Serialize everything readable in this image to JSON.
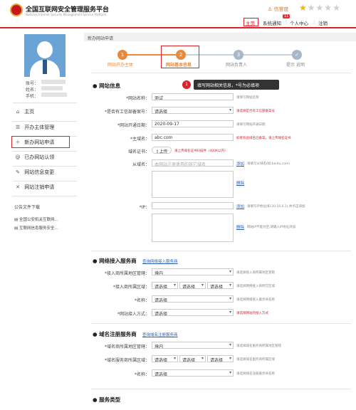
{
  "header": {
    "title": "全国互联网安全管理服务平台",
    "subtitle": "National Internet Security Management Service Platform",
    "level_label": "信誉度",
    "stars_on": 1,
    "stars_total": 5,
    "nav": [
      "主页",
      "系统通知",
      "个人中心",
      "注销"
    ],
    "notice_count": "11"
  },
  "sidebar": {
    "account_label": "账号：",
    "name_label": "姓名：",
    "phone_label": "手机：",
    "items": [
      {
        "icon": "home-icon",
        "label": "主页"
      },
      {
        "icon": "list-icon",
        "label": "开办主体管理"
      },
      {
        "icon": "plus-icon",
        "label": "新办网站申请"
      },
      {
        "icon": "at-icon",
        "label": "已办网站认领"
      },
      {
        "icon": "edit-icon",
        "label": "网站信息变更"
      },
      {
        "icon": "close-icon",
        "label": "网站注销申请"
      }
    ],
    "downloads_title": "公告文件下载",
    "downloads": [
      "全国公安机关互联网...",
      "互联网信息服务安全..."
    ]
  },
  "main": {
    "title": "新办网站申请",
    "steps": [
      "网站开办主体",
      "网站基本信息",
      "网站负责人",
      "提示 说明"
    ],
    "tooltip": "填写网站相关信息，*号为必填项",
    "tooltip_num": "1",
    "site_section": "网站信息",
    "site_name_label": "*网站名称：",
    "site_name_value": "测试",
    "site_name_hint": "请填写网站名称",
    "record_label": "*是否有工信部备案号：",
    "record_value": "请选择",
    "record_hint": "请选择是否有工信部备案号",
    "open_date_label": "*网站开通日期：",
    "open_date_value": "2020-09-17",
    "open_date_hint": "请填写网站开通日期",
    "domain_label": "*主域名：",
    "domain_value": "abc.com",
    "domain_hint": "如者有此域名已备案，请上传域名证书",
    "cert_label": "域名证书：",
    "upload_label": "上传",
    "cert_hint": "请上传域名证书扫描件（400K以内）",
    "subdomain_label": "从域名：",
    "subdomain_placeholder": "本网站注册使用的其它域名",
    "add_label": "添加",
    "subdomain_hint": "请填写从域名(如:baidu.com)",
    "delete_label": "删除",
    "ip_label": "*IP：",
    "ip_hint": "请填写IP地址(如:20.10.0.1),并点击添加",
    "ip_hint2": "网站IP不能为空,请输入IP地址添加",
    "access_section": "网络接入服务商",
    "access_link": "查询网络接入服务商",
    "access_loc_label": "*接入商所属地区管辖：",
    "access_loc_value": "境内",
    "access_loc_hint": "请选择接入商所属地区管辖",
    "access_area_label": "*接入商所属区域：",
    "area_values": [
      "请选择",
      "请选择",
      "请选择"
    ],
    "access_area_hint": "请选择网络接入商所在区域",
    "access_name_label": "*名称：",
    "access_name_value": "请选择",
    "access_name_hint": "请选择网络接入服务商名称",
    "access_mode_label": "*网站接入方式：",
    "access_mode_value": "请选择",
    "access_mode_hint": "请选择网站的接入方式",
    "reg_section": "域名注册服务商",
    "reg_link": "查询域名注册服务商",
    "reg_loc_label": "*域名商所属地区管辖：",
    "reg_loc_value": "境内",
    "reg_loc_hint": "请选择域名服务商所属地区管辖",
    "reg_area_label": "*域名服务商所属区域：",
    "reg_area_hint": "请选择域名服务商所属区域",
    "reg_name_label": "*名称：",
    "reg_name_value": "请选择",
    "reg_name_hint": "请选择域名注册服务商名称",
    "service_section": "服务类型"
  },
  "colors": {
    "accent": "#d4262c",
    "step_active": "#e88a3a",
    "step_idle": "#a8b8c8",
    "avatar_bg": "#6aa4d6"
  }
}
